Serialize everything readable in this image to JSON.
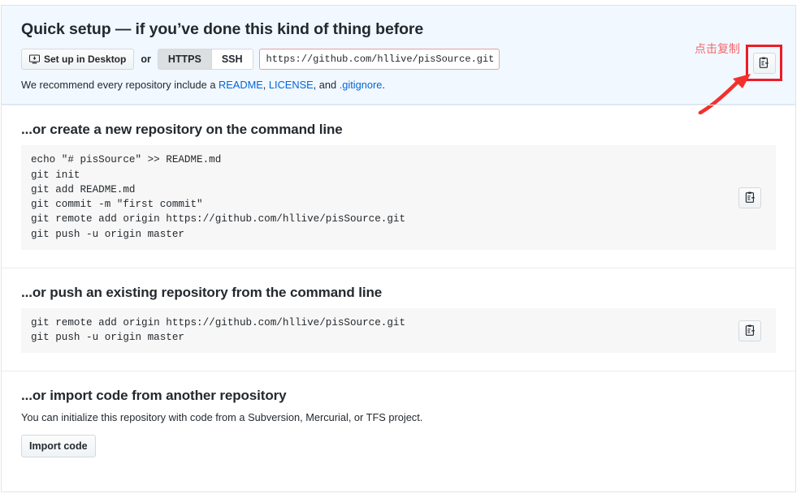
{
  "quick_setup": {
    "title": "Quick setup — if you’ve done this kind of thing before",
    "desktop_button": "Set up in Desktop",
    "desktop_icon": "desktop-download-icon",
    "or_label": "or",
    "protocols": [
      {
        "label": "HTTPS",
        "selected": true
      },
      {
        "label": "SSH",
        "selected": false
      }
    ],
    "clone_url": "https://github.com/hllive/pisSource.git",
    "copy_icon": "clipboard-copy-icon",
    "note_prefix": "We recommend every repository include a ",
    "note_links": [
      "README",
      "LICENSE",
      ".gitignore"
    ],
    "note_mid": ", ",
    "note_and": ", and ",
    "note_suffix": ".",
    "annotation": {
      "text": "点击复制",
      "color": "#f4676b",
      "highlight_color": "#ee1c25",
      "arrow_icon": "arrow-pointer-icon"
    },
    "background_color": "#f1f8ff"
  },
  "sections": [
    {
      "title": "...or create a new repository on the command line",
      "code": "echo \"# pisSource\" >> README.md\ngit init\ngit add README.md\ngit commit -m \"first commit\"\ngit remote add origin https://github.com/hllive/pisSource.git\ngit push -u origin master",
      "copy_icon": "clipboard-copy-icon"
    },
    {
      "title": "...or push an existing repository from the command line",
      "code": "git remote add origin https://github.com/hllive/pisSource.git\ngit push -u origin master",
      "copy_icon": "clipboard-copy-icon"
    }
  ],
  "import_section": {
    "title": "...or import code from another repository",
    "note": "You can initialize this repository with code from a Subversion, Mercurial, or TFS project.",
    "button": "Import code"
  },
  "colors": {
    "link": "#0366d6",
    "text": "#24292e",
    "panel_border": "#e1e4e8",
    "code_bg": "#f7f7f7",
    "divider": "#eaecef"
  }
}
